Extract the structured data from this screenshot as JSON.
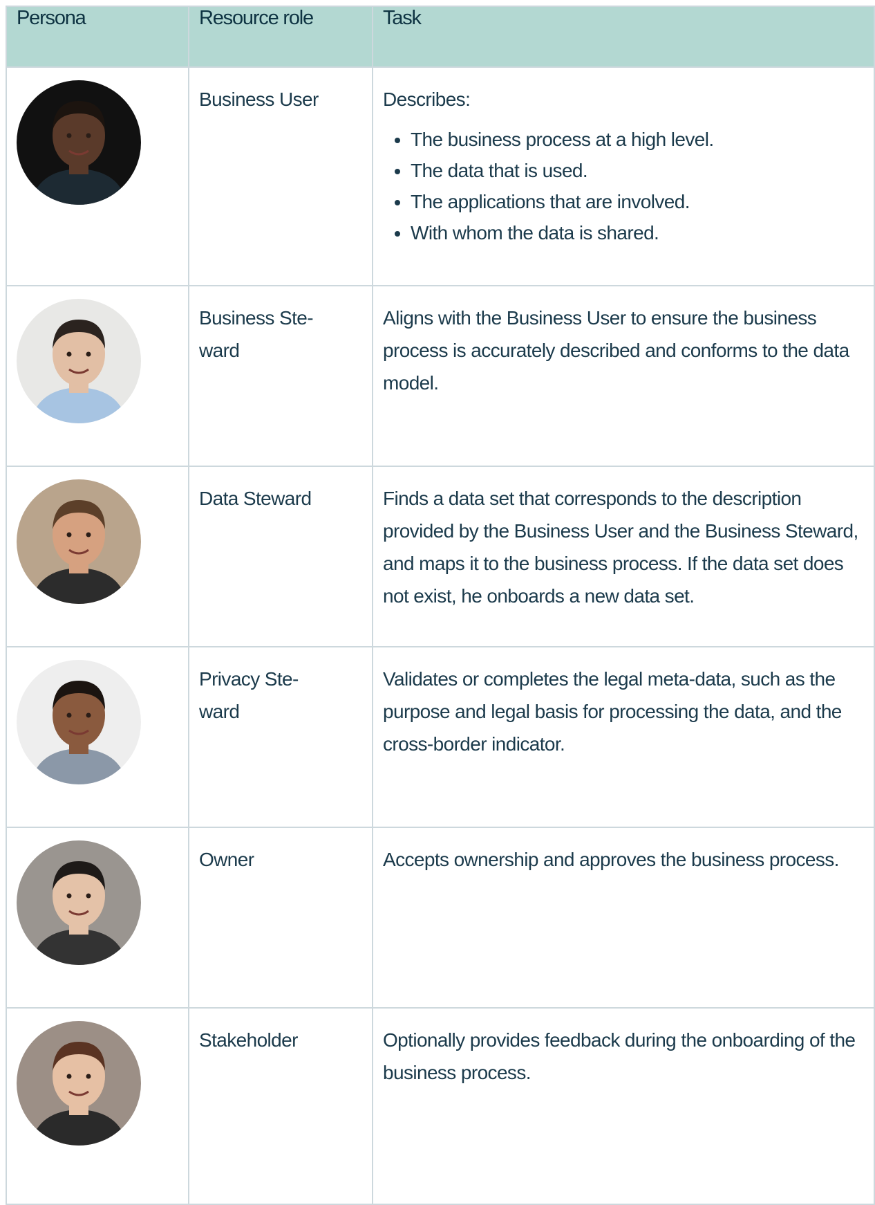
{
  "header": {
    "persona": "Persona",
    "resource_role": "Resource role",
    "task": "Task"
  },
  "rows": [
    {
      "role": "Business User",
      "task_intro": "Describes:",
      "task_bullets": [
        "The business process at a high level.",
        "The data that is used.",
        "The applications that are involved.",
        "With whom the data is shared."
      ],
      "avatar": {
        "skin": "#5a3a2a",
        "hair": "#1c140f",
        "shirt": "#1d2a33",
        "bg": "#111111"
      }
    },
    {
      "role": "Business Ste-\nward",
      "task": "Aligns with the Business User to ensure the business process is accurately described and conforms to the data model.",
      "avatar": {
        "skin": "#e2bfa5",
        "hair": "#2b231f",
        "shirt": "#a7c4e2",
        "bg": "#e8e8e6"
      }
    },
    {
      "role": "Data Steward",
      "task": "Finds a data set that corresponds to the description provided by the Business User and the Business Steward, and maps it to the business process. If the data set does not exist, he onboards a new data set.",
      "avatar": {
        "skin": "#d6a180",
        "hair": "#5c3f29",
        "shirt": "#2c2c2c",
        "bg": "#b9a48c"
      }
    },
    {
      "role": "Privacy Ste-\nward",
      "task": "Validates or completes the legal meta-data, such as the purpose and legal basis for processing the data, and the cross-border indicator.",
      "avatar": {
        "skin": "#8a5a3e",
        "hair": "#1b1410",
        "shirt": "#8b98a8",
        "bg": "#eeeeee"
      }
    },
    {
      "role": "Owner",
      "task": "Accepts ownership and approves the business process.",
      "avatar": {
        "skin": "#e4c2a8",
        "hair": "#1e1a18",
        "shirt": "#333333",
        "bg": "#9a9590"
      }
    },
    {
      "role": "Stakeholder",
      "task": "Optionally provides feedback during the onboarding of the business process.",
      "avatar": {
        "skin": "#e6c0a4",
        "hair": "#5a3322",
        "shirt": "#2a2a2a",
        "bg": "#9c8f86"
      }
    }
  ]
}
